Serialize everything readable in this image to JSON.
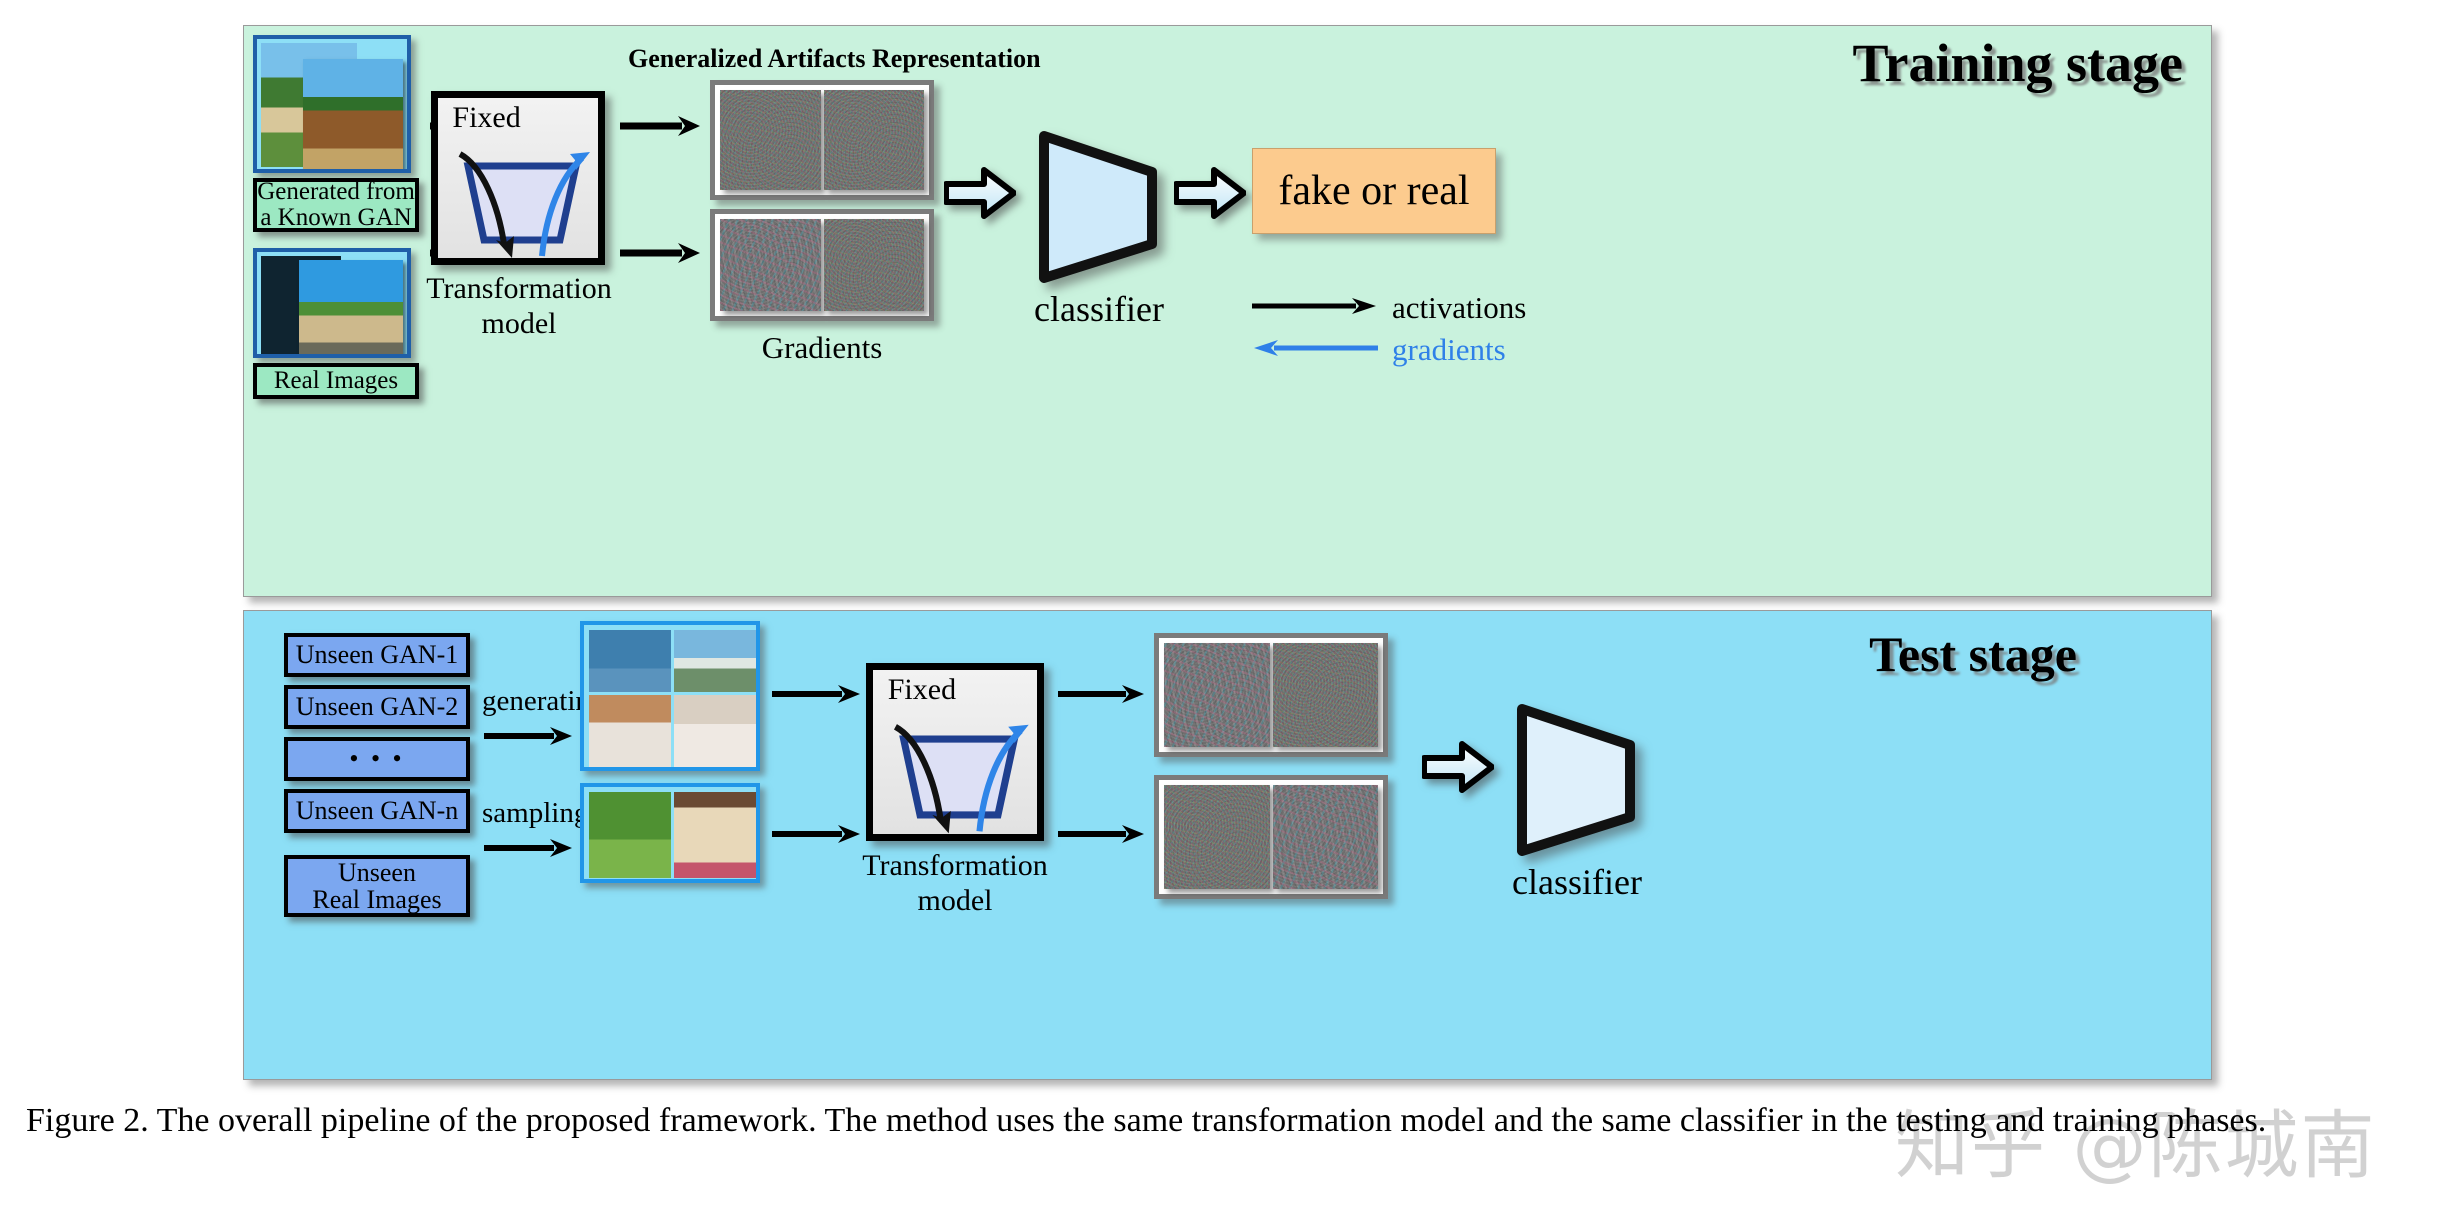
{
  "figure": {
    "caption": "Figure 2. The overall pipeline of the proposed framework. The method uses the same transformation model and the same classifier in the testing and training phases.",
    "watermark": "知乎 @陈城南"
  },
  "training": {
    "title": "Training stage",
    "background_color": "#c9f2dd",
    "inputs": [
      {
        "label": "Generated from\na Known GAN",
        "kind": "generated"
      },
      {
        "label": "Real Images",
        "kind": "real"
      }
    ],
    "transformation": {
      "fixed_label": "Fixed",
      "caption_line1": "Transformation",
      "caption_line2": "model"
    },
    "artifacts_title": "Generalized Artifacts Representation",
    "gradients_label": "Gradients",
    "classifier_label": "classifier",
    "output_label": "fake or real",
    "output_color": "#fccb8e",
    "legend": [
      {
        "label": "activations",
        "color": "#000000",
        "direction": "right"
      },
      {
        "label": "gradients",
        "color": "#2f80e8",
        "direction": "left"
      }
    ]
  },
  "test": {
    "title": "Test stage",
    "background_color": "#8ddff6",
    "sources": [
      {
        "label": "Unseen GAN-1"
      },
      {
        "label": "Unseen GAN-2"
      },
      {
        "label": "• • •"
      },
      {
        "label": "Unseen GAN-n"
      },
      {
        "label": "Unseen\nReal Images"
      }
    ],
    "arrow_labels": [
      {
        "label": "generating"
      },
      {
        "label": "sampling"
      }
    ],
    "transformation": {
      "fixed_label": "Fixed",
      "caption_line1": "Transformation",
      "caption_line2": "model"
    },
    "classifier_label": "classifier"
  }
}
